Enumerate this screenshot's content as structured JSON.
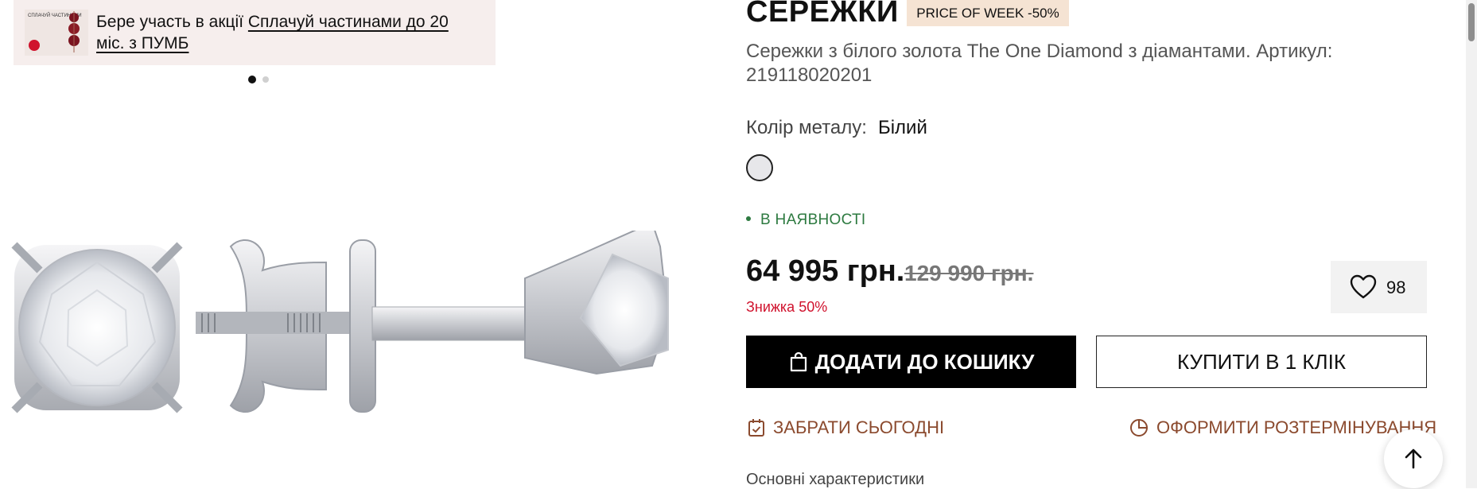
{
  "promo": {
    "thumb_title": "СПЛАЧУЙ ЧАСТИНАМИ",
    "lead_text": "Бере участь в акції ",
    "link_text": "Сплачуй частинами до 20 міс. з ПУМБ"
  },
  "gallery": {
    "slides_total": 2,
    "active_slide": 1
  },
  "product": {
    "title": "СЕРЕЖКИ",
    "badge": "PRICE OF WEEK -50%",
    "description": "Сережки з білого золота The One Diamond з діамантами. Артикул: 219118020201",
    "metal_label": "Колір металу:",
    "metal_value": "Білий",
    "stock_status": "В НАЯВНОСТІ",
    "price": "64 995 грн.",
    "old_price": "129 990 грн.",
    "discount": "Знижка 50%",
    "wishlist_count": "98"
  },
  "actions": {
    "add_to_cart": "ДОДАТИ ДО КОШИКУ",
    "buy_one_click": "КУПИТИ В 1 КЛІК",
    "pickup_today": "ЗАБРАТИ СЬОГОДНІ",
    "installment": "ОФОРМИТИ РОЗТЕРМІНУВАННЯ"
  },
  "sections": {
    "main_characteristics": "Основні характеристики"
  },
  "colors": {
    "accent_brown": "#8b4a2e",
    "stock_green": "#2d7a40",
    "discount_red": "#d0122d",
    "badge_bg": "#f5e3d3",
    "promo_bg": "#f6eeed"
  }
}
